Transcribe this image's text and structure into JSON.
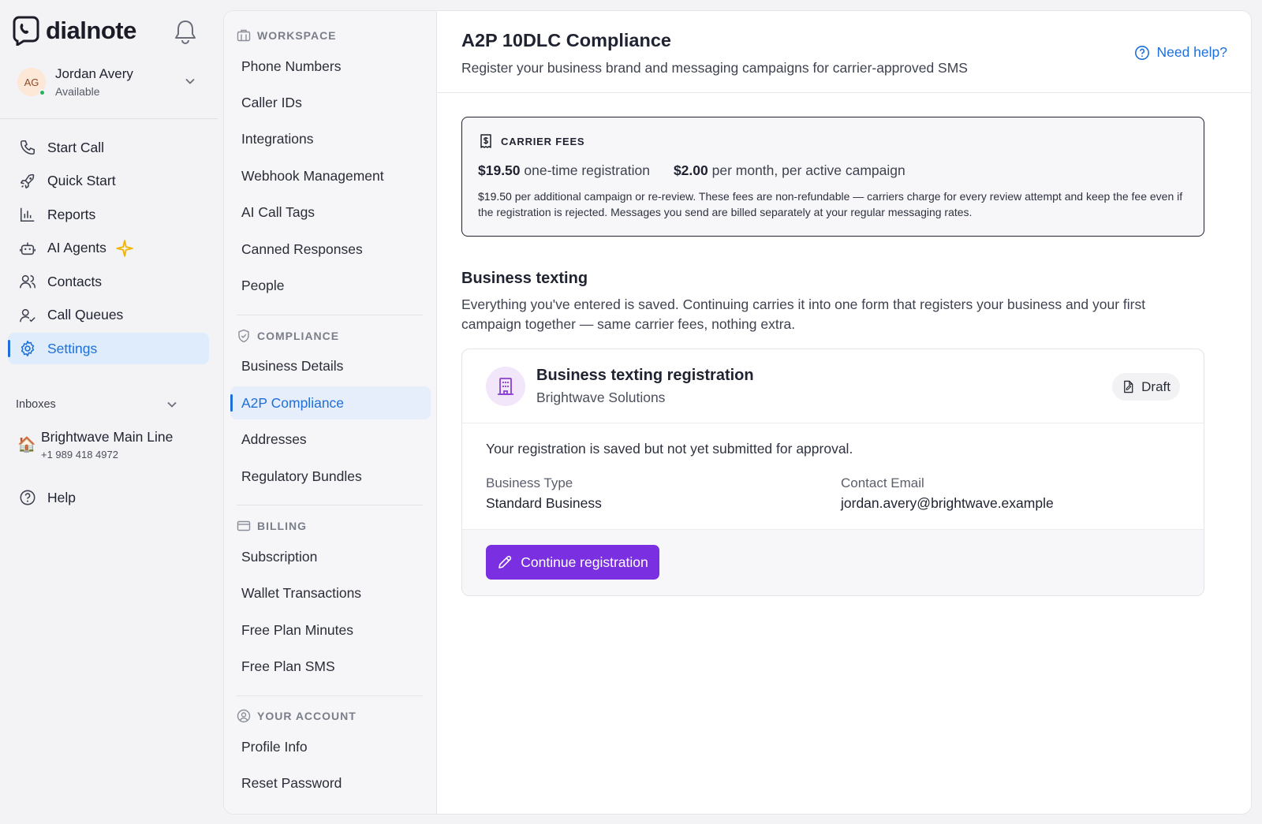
{
  "brand": {
    "name": "dialnote"
  },
  "user": {
    "initials": "AG",
    "name": "Jordan Avery",
    "status": "Available"
  },
  "nav": {
    "items": [
      {
        "label": "Start Call",
        "icon": "phone-icon"
      },
      {
        "label": "Quick Start",
        "icon": "rocket-icon"
      },
      {
        "label": "Reports",
        "icon": "bar-chart-icon"
      },
      {
        "label": "AI Agents",
        "icon": "robot-icon"
      },
      {
        "label": "Contacts",
        "icon": "contacts-icon"
      },
      {
        "label": "Call Queues",
        "icon": "user-check-icon"
      },
      {
        "label": "Settings",
        "icon": "gear-icon",
        "active": true
      }
    ]
  },
  "inboxes": {
    "heading": "Inboxes",
    "items": [
      {
        "emoji": "🏠",
        "name": "Brightwave Main Line",
        "number": "+1 989 418 4972"
      }
    ]
  },
  "help": {
    "label": "Help"
  },
  "settings_nav": {
    "workspace": {
      "heading": "WORKSPACE",
      "items": [
        "Phone Numbers",
        "Caller IDs",
        "Integrations",
        "Webhook Management",
        "AI Call Tags",
        "Canned Responses",
        "People"
      ]
    },
    "compliance": {
      "heading": "COMPLIANCE",
      "items": [
        "Business Details",
        "A2P Compliance",
        "Addresses",
        "Regulatory Bundles"
      ],
      "active": "A2P Compliance"
    },
    "billing": {
      "heading": "BILLING",
      "items": [
        "Subscription",
        "Wallet Transactions",
        "Free Plan Minutes",
        "Free Plan SMS"
      ]
    },
    "account": {
      "heading": "YOUR ACCOUNT",
      "items": [
        "Profile Info",
        "Reset Password"
      ]
    }
  },
  "page": {
    "title": "A2P 10DLC Compliance",
    "subtitle": "Register your business brand and messaging campaigns for carrier-approved SMS",
    "help_link": "Need help?"
  },
  "fees": {
    "heading": "CARRIER FEES",
    "registration_amount": "$19.50",
    "registration_label": "one-time registration",
    "monthly_amount": "$2.00",
    "monthly_label": "per month, per active campaign",
    "note_amount": "$19.50",
    "note_text": "per additional campaign or re-review. These fees are non-refundable — carriers charge for every review attempt and keep the fee even if the registration is rejected. Messages you send are billed separately at your regular messaging rates."
  },
  "business_texting": {
    "title": "Business texting",
    "description": "Everything you've entered is saved. Continuing carries it into one form that registers your business and your first campaign together — same carrier fees, nothing extra."
  },
  "registration_card": {
    "title": "Business texting registration",
    "organization": "Brightwave Solutions",
    "status": "Draft",
    "message": "Your registration is saved but not yet submitted for approval.",
    "business_type_label": "Business Type",
    "business_type_value": "Standard Business",
    "contact_email_label": "Contact Email",
    "contact_email_value": "jordan.avery@brightwave.example",
    "continue_label": "Continue registration"
  },
  "colors": {
    "accent": "#1e6fd9",
    "primary_button": "#7a2fe0",
    "status_online": "#22b45a"
  }
}
